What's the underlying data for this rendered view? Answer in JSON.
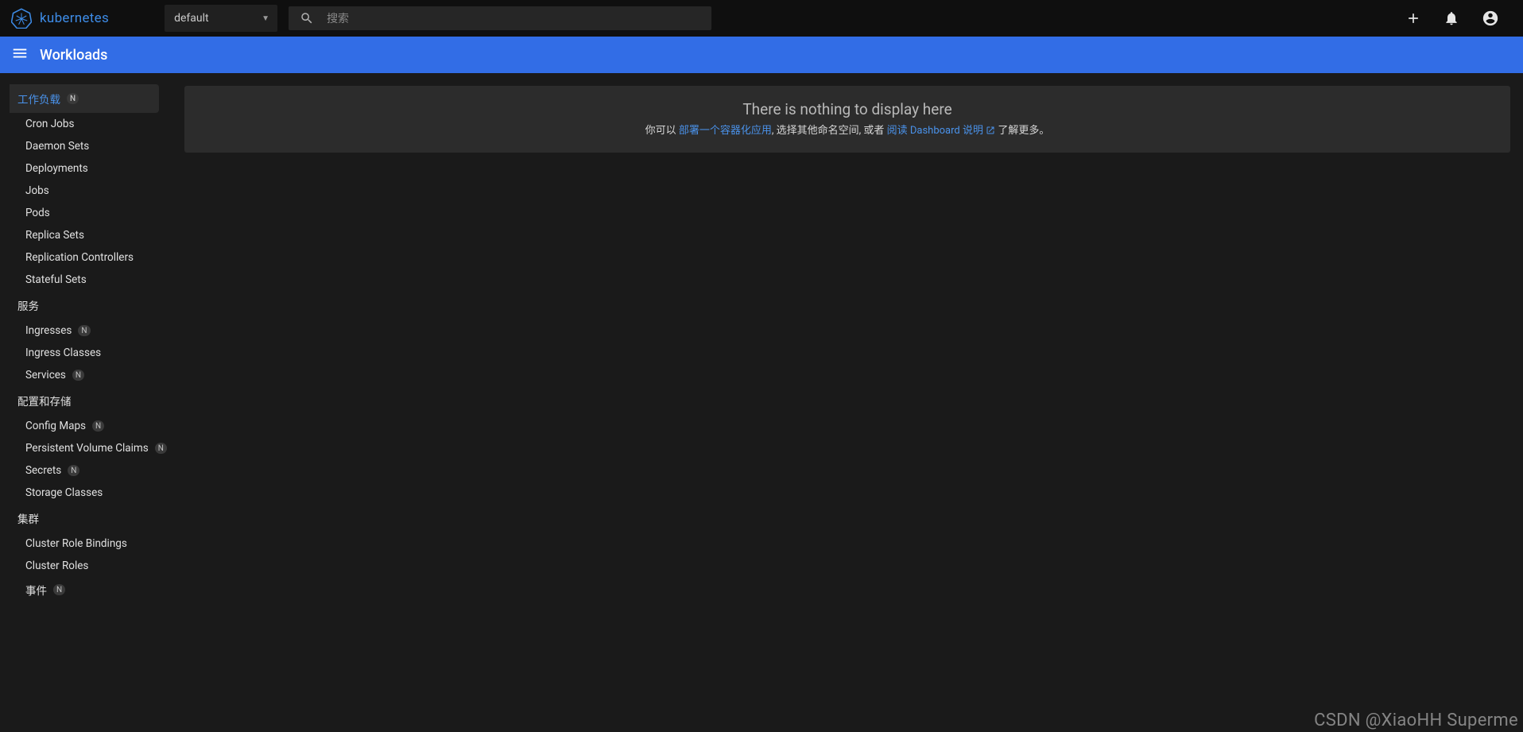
{
  "brand": {
    "name": "kubernetes"
  },
  "namespace": {
    "selected": "default"
  },
  "search": {
    "placeholder": "搜索"
  },
  "header": {
    "title": "Workloads"
  },
  "sidebar": {
    "workloads": {
      "title": "工作负载",
      "badge": "N",
      "items": [
        {
          "label": "Cron Jobs"
        },
        {
          "label": "Daemon Sets"
        },
        {
          "label": "Deployments"
        },
        {
          "label": "Jobs"
        },
        {
          "label": "Pods"
        },
        {
          "label": "Replica Sets"
        },
        {
          "label": "Replication Controllers"
        },
        {
          "label": "Stateful Sets"
        }
      ]
    },
    "services": {
      "title": "服务",
      "items": [
        {
          "label": "Ingresses",
          "badge": "N"
        },
        {
          "label": "Ingress Classes"
        },
        {
          "label": "Services",
          "badge": "N"
        }
      ]
    },
    "config": {
      "title": "配置和存储",
      "items": [
        {
          "label": "Config Maps",
          "badge": "N"
        },
        {
          "label": "Persistent Volume Claims",
          "badge": "N"
        },
        {
          "label": "Secrets",
          "badge": "N"
        },
        {
          "label": "Storage Classes"
        }
      ]
    },
    "cluster": {
      "title": "集群",
      "items": [
        {
          "label": "Cluster Role Bindings"
        },
        {
          "label": "Cluster Roles"
        },
        {
          "label": "事件",
          "badge": "N"
        }
      ]
    }
  },
  "notice": {
    "title": "There is nothing to display here",
    "pre": "你可以 ",
    "link1": "部署一个容器化应用",
    "mid": ", 选择其他命名空间,   或者 ",
    "link2": "阅读 Dashboard 说明",
    "post": " 了解更多。"
  },
  "watermark": "CSDN @XiaoHH Superme"
}
